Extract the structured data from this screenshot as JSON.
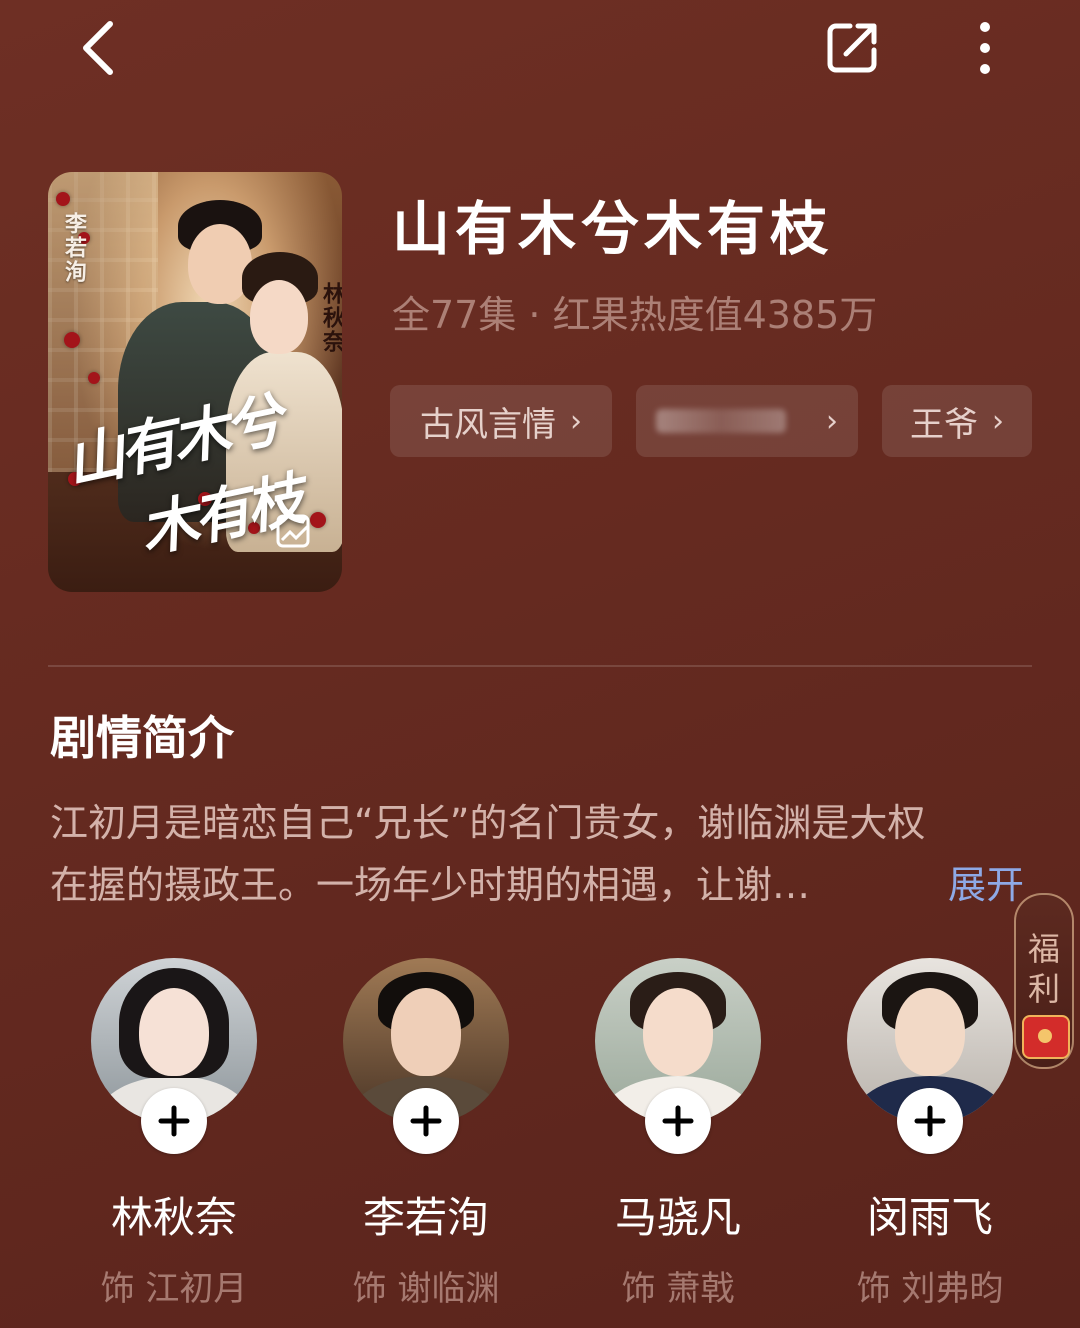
{
  "header": {
    "back_icon": "chevron-left-icon",
    "share_icon": "share-icon",
    "more_icon": "more-vertical-icon"
  },
  "drama": {
    "title": "山有木兮木有枝",
    "meta": "全77集 · 红果热度值4385万",
    "poster": {
      "calligraphy_line1": "山有木兮",
      "calligraphy_line2": "木有枝",
      "actor_left": "李若洵",
      "actor_right": "林秋奈"
    },
    "tags": [
      {
        "label": "古风言情"
      },
      {
        "label": ""
      },
      {
        "label": "王爷"
      }
    ]
  },
  "synopsis": {
    "heading": "剧情简介",
    "line1": "江初月是暗恋自己“兄长”的名门贵女，谢临渊是大权",
    "line2": "在握的摄政王。一场年少时期的相遇，让谢…",
    "expand_label": "展开"
  },
  "cast": [
    {
      "name": "林秋奈",
      "role": "饰 江初月"
    },
    {
      "name": "李若洵",
      "role": "饰 谢临渊"
    },
    {
      "name": "马骁凡",
      "role": "饰 萧戟"
    },
    {
      "name": "闵雨飞",
      "role": "饰 刘弗昀"
    }
  ],
  "floating_widget": {
    "label": "福利",
    "icon": "red-envelope-icon"
  },
  "colors": {
    "background": "#6a2d23",
    "expand_link": "#8ea9e6"
  }
}
